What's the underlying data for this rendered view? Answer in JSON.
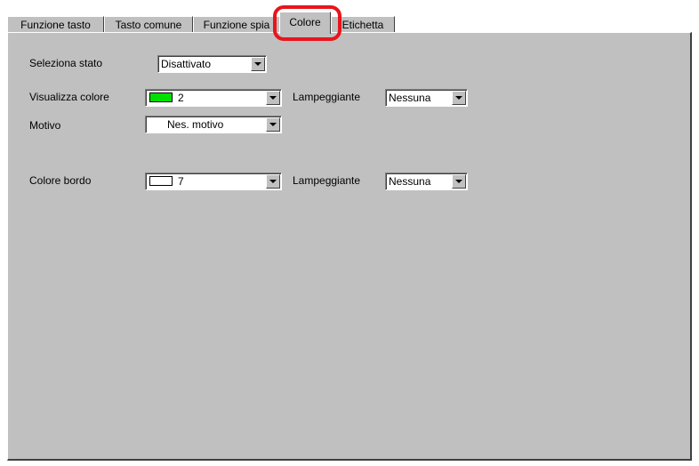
{
  "tabs": [
    {
      "label": "Funzione tasto"
    },
    {
      "label": "Tasto comune"
    },
    {
      "label": "Funzione spia"
    },
    {
      "label": "Colore"
    },
    {
      "label": "Etichetta"
    }
  ],
  "active_tab": "Colore",
  "form": {
    "select_state": {
      "label": "Seleziona stato",
      "value": "Disattivato"
    },
    "display_color": {
      "label": "Visualizza colore",
      "value": "2",
      "swatch_color": "#00e000"
    },
    "display_blink": {
      "label": "Lampeggiante",
      "value": "Nessuna"
    },
    "pattern": {
      "label": "Motivo",
      "value": "Nes. motivo"
    },
    "border_color": {
      "label": "Colore bordo",
      "value": "7",
      "swatch_color": "#ffffff"
    },
    "border_blink": {
      "label": "Lampeggiante",
      "value": "Nessuna"
    }
  },
  "colors": {
    "highlight": "#e8141c",
    "panel": "#c0c0c0"
  }
}
